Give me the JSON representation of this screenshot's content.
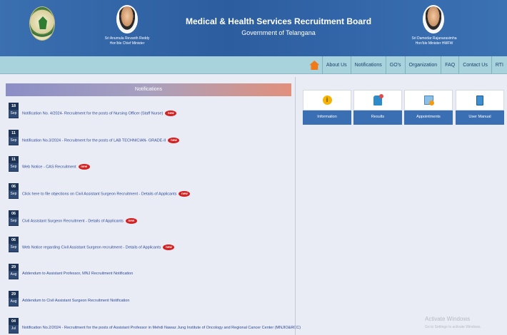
{
  "header": {
    "title": "Medical & Health Services Recruitment Board",
    "subtitle": "Government of Telangana",
    "left_person": {
      "name": "Sri Anumula Revanth Reddy",
      "role": "Hon'ble Chief Minister"
    },
    "right_person": {
      "name": "Sri Damodar Rajanarasimha",
      "role": "Hon'ble Minister HMFW"
    }
  },
  "nav": {
    "home_icon": "home-icon",
    "items": [
      {
        "label": "About Us"
      },
      {
        "label": "Notifications"
      },
      {
        "label": "GO's"
      },
      {
        "label": "Organization"
      },
      {
        "label": "FAQ"
      },
      {
        "label": "Contact Us"
      },
      {
        "label": "RTI"
      }
    ]
  },
  "notifications": {
    "title": "Notifications",
    "new_badge": "new",
    "items": [
      {
        "day": "18",
        "month": "Sep",
        "text": "Notification No. 4/2024- Recruitment for the posts of Nursing Officer (Staff Nurse)",
        "is_new": true
      },
      {
        "day": "11",
        "month": "Sep",
        "text": "Notification No.3/2024 - Recruitment for the posts of LAB TECHNICIAN- GRADE-II",
        "is_new": true
      },
      {
        "day": "11",
        "month": "Sep",
        "text": "Web Notice - CAS Recruitment",
        "is_new": true
      },
      {
        "day": "06",
        "month": "Sep",
        "text": "Click here to file objections on Civil Assistant Surgeon Recruitment - Details of Applicants",
        "is_new": true
      },
      {
        "day": "06",
        "month": "Sep",
        "text": "Civil Assistant Surgeon Recruitment - Details of Applicants",
        "is_new": true
      },
      {
        "day": "06",
        "month": "Sep",
        "text": "Web Notice regarding Civil Assistant Surgeon recruitment - Details of Applicants",
        "is_new": true
      },
      {
        "day": "29",
        "month": "Aug",
        "text": "Addendum to Assistant Professor, MNJ Recruitment Notification",
        "is_new": false
      },
      {
        "day": "29",
        "month": "Aug",
        "text": "Addendum to Civil Assistant Surgeon Recruitment Notification",
        "is_new": false
      },
      {
        "day": "04",
        "month": "Jul",
        "text": "Notification No.2/2024 - Recruitment for the posts of Assistant Professor in Mehdi Nawaz Jung Institute of Oncology and Regional Cancer Center (MNJIO&RCC)",
        "is_new": false
      }
    ]
  },
  "tiles": [
    {
      "label": "Information",
      "icon": "info-icon"
    },
    {
      "label": "Results",
      "icon": "results-icon"
    },
    {
      "label": "Appointments",
      "icon": "appointments-icon"
    },
    {
      "label": "User Manual",
      "icon": "user-manual-icon"
    }
  ],
  "watermark": {
    "title": "Activate Windows",
    "subtitle": "Go to Settings to activate Windows."
  }
}
